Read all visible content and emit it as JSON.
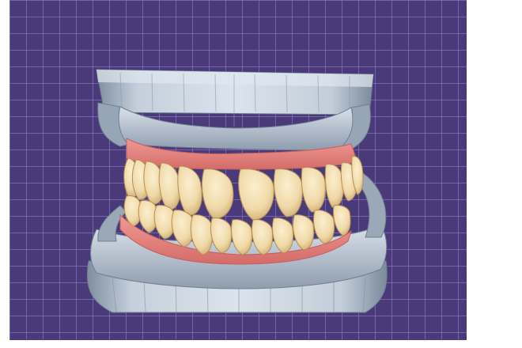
{
  "viewport": {
    "background_color": "#4a3a7a",
    "grid_color": "#9687cd",
    "model_colors": {
      "stone": "#a9b6c4",
      "stone_highlight": "#d7e0ea",
      "stone_shadow": "#6f7f90",
      "gingiva": "#e98a86",
      "gingiva_shadow": "#c9605e",
      "teeth": "#f2ddb0",
      "teeth_shadow": "#caa86a"
    }
  },
  "model": {
    "name_icon": "dental-model-icon"
  }
}
